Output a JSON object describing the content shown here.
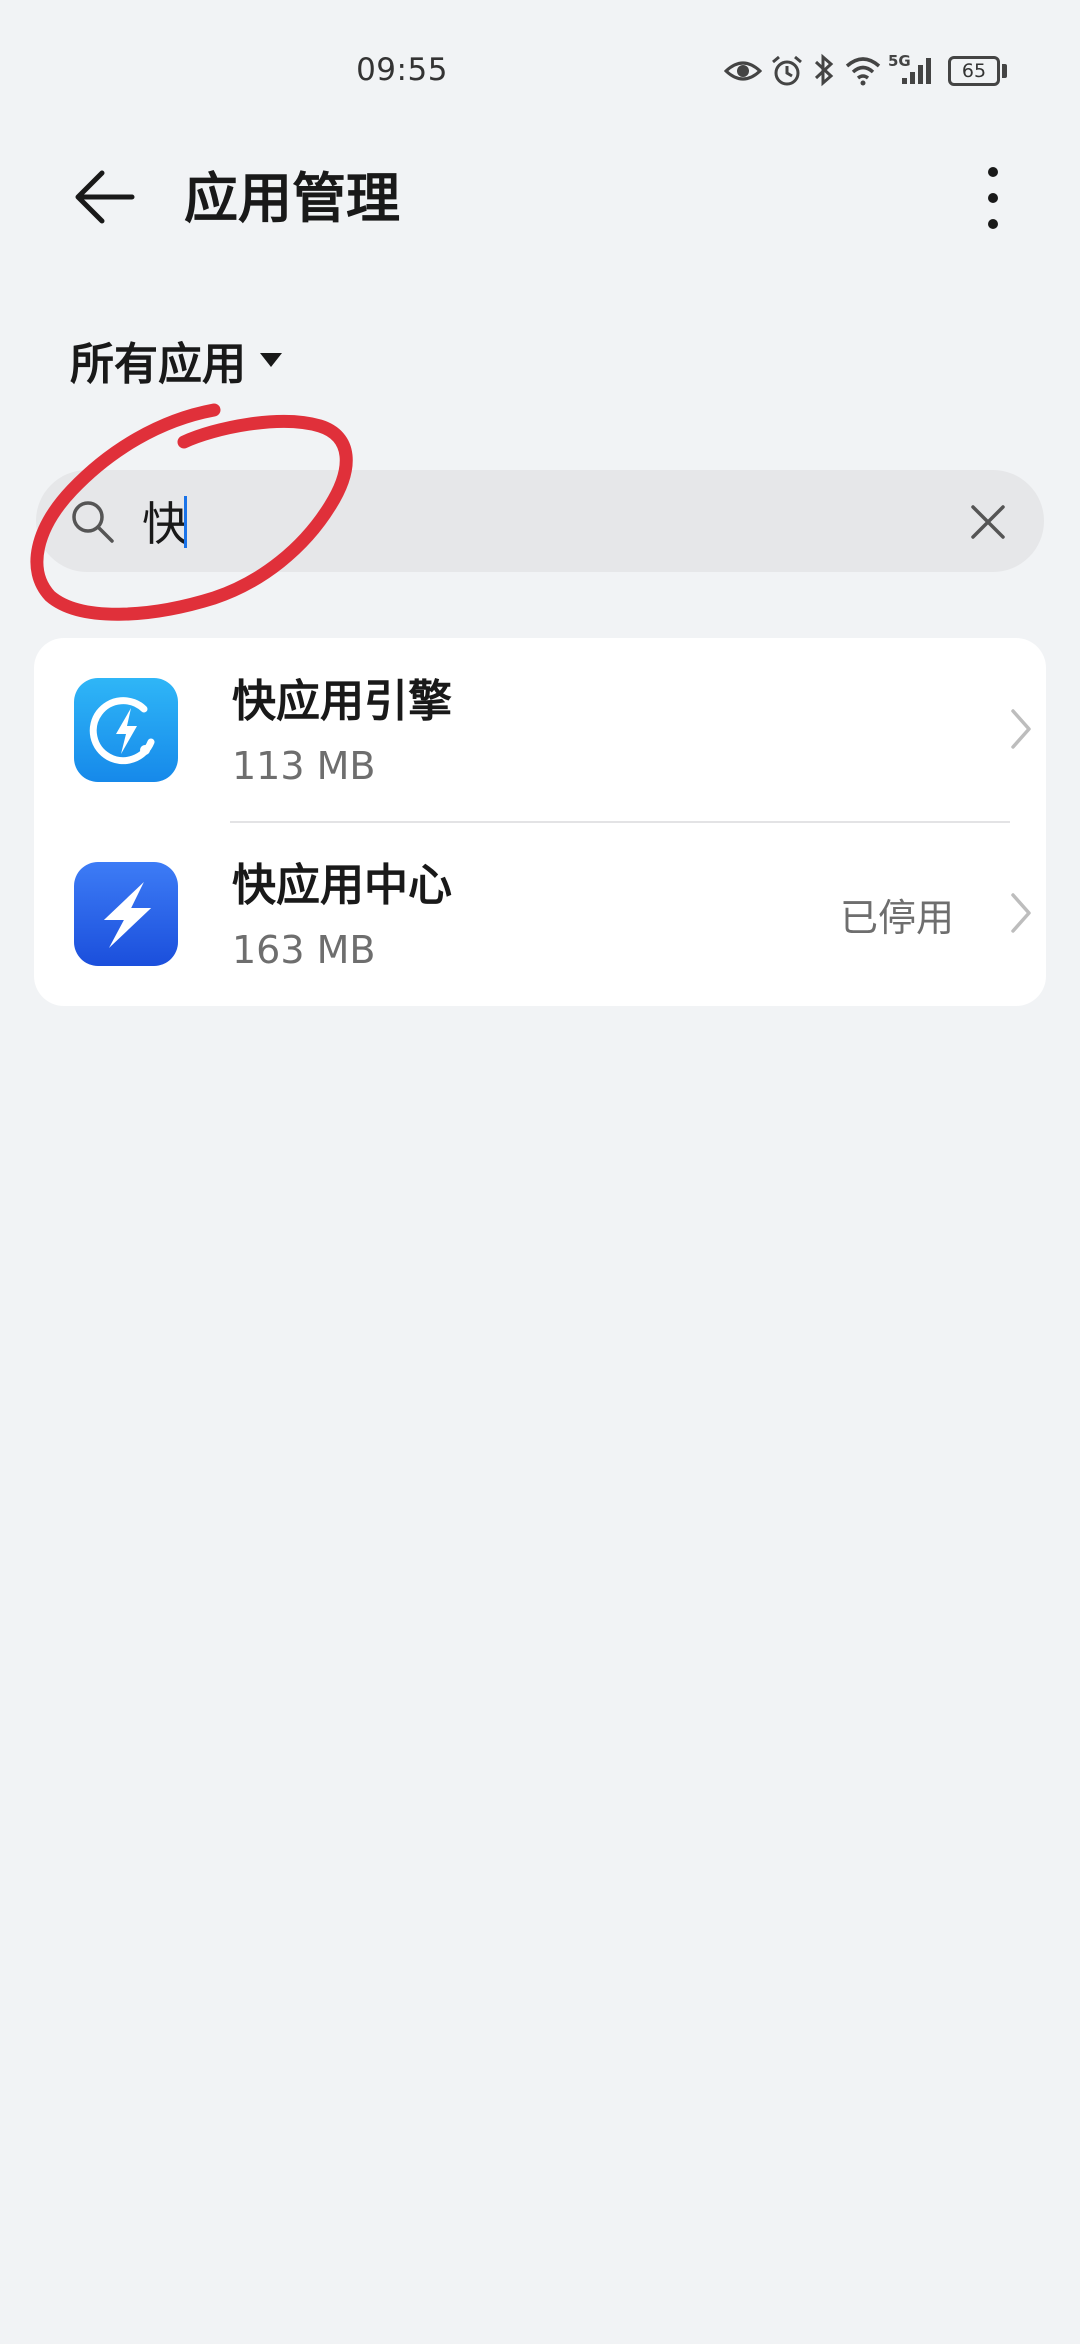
{
  "status_bar": {
    "time": "09:55",
    "network": "5G",
    "battery": "65",
    "icons": [
      "eye-comfort-icon",
      "alarm-icon",
      "bluetooth-icon",
      "wifi-icon",
      "cellular-signal-icon",
      "battery-icon"
    ]
  },
  "header": {
    "title": "应用管理",
    "back_icon": "arrow-left-icon",
    "more_icon": "more-vertical-icon"
  },
  "filter": {
    "label": "所有应用"
  },
  "search": {
    "value": "快",
    "search_icon": "search-icon",
    "clear_icon": "close-icon"
  },
  "apps": [
    {
      "name": "快应用引擎",
      "size": "113 MB",
      "status": ""
    },
    {
      "name": "快应用中心",
      "size": "163 MB",
      "status": "已停用"
    }
  ],
  "colors": {
    "background": "#f1f3f5",
    "annotation": "#e0303a",
    "accent": "#1a73e8"
  }
}
